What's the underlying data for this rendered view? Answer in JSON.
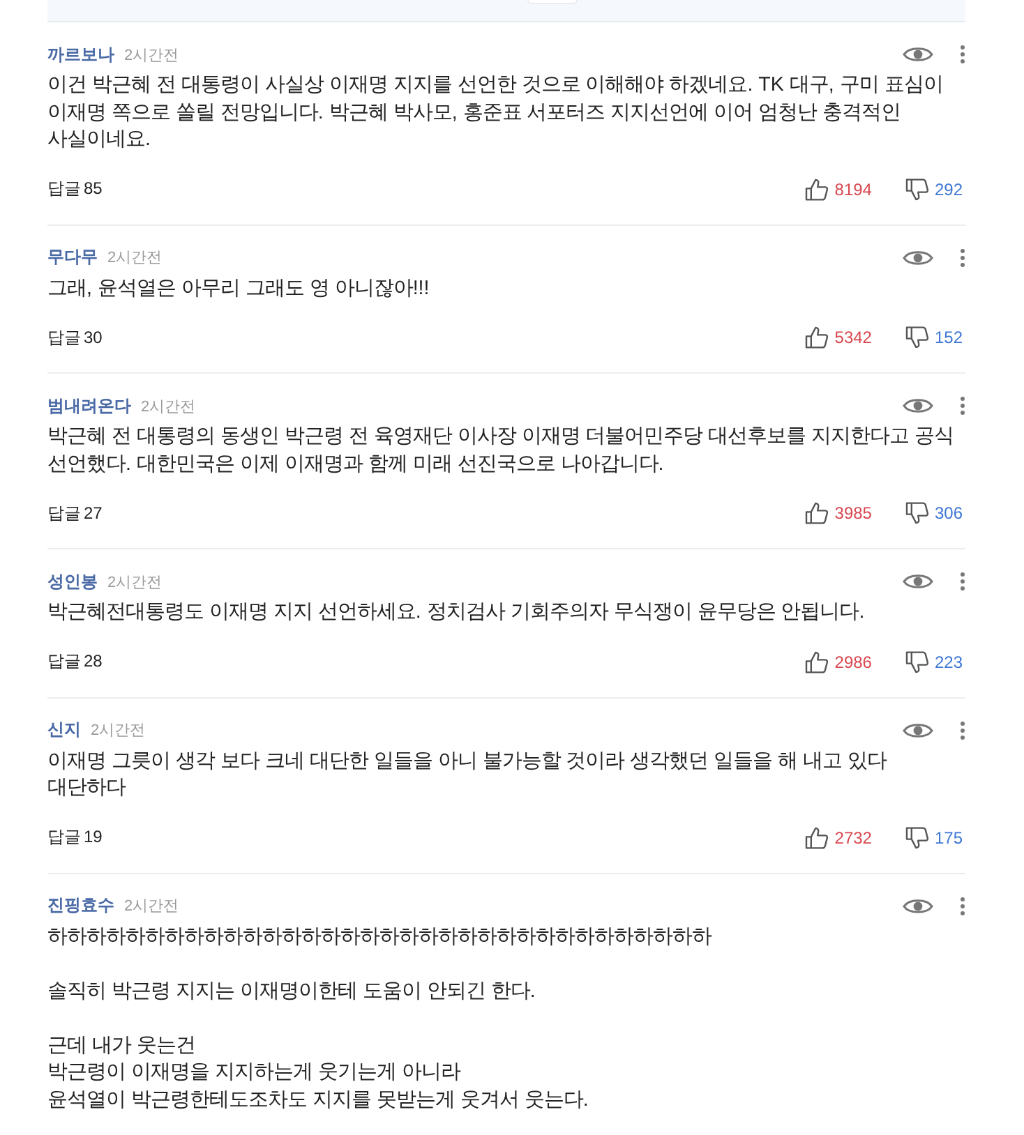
{
  "comments": [
    {
      "author": "까르보나",
      "time": "2시간전",
      "body": "이건 박근혜 전 대통령이 사실상 이재명 지지를 선언한 것으로 이해해야 하겠네요. TK 대구, 구미 표심이 이재명 쪽으로 쏠릴 전망입니다. 박근혜 박사모, 홍준표 서포터즈 지지선언에 이어 엄청난 충격적인 사실이네요.",
      "reply_label": "답글",
      "reply_count": "85",
      "likes": "8194",
      "dislikes": "292"
    },
    {
      "author": "무다무",
      "time": "2시간전",
      "body": "그래, 윤석열은 아무리 그래도 영 아니잖아!!!",
      "reply_label": "답글",
      "reply_count": "30",
      "likes": "5342",
      "dislikes": "152"
    },
    {
      "author": "범내려온다",
      "time": "2시간전",
      "body": "박근혜 전 대통령의 동생인 박근령 전 육영재단 이사장 이재명 더불어민주당 대선후보를 지지한다고 공식 선언했다. 대한민국은 이제 이재명과 함께 미래 선진국으로 나아갑니다.",
      "reply_label": "답글",
      "reply_count": "27",
      "likes": "3985",
      "dislikes": "306"
    },
    {
      "author": "성인봉",
      "time": "2시간전",
      "body": "박근혜전대통령도 이재명 지지 선언하세요. 정치검사 기회주의자 무식쟁이 윤무당은 안됩니다.",
      "reply_label": "답글",
      "reply_count": "28",
      "likes": "2986",
      "dislikes": "223"
    },
    {
      "author": "신지",
      "time": "2시간전",
      "body": "이재명 그릇이 생각 보다 크네 대단한 일들을 아니 불가능할 것이라 생각했던 일들을 해 내고 있다\n대단하다",
      "reply_label": "답글",
      "reply_count": "19",
      "likes": "2732",
      "dislikes": "175"
    },
    {
      "author": "진핑효수",
      "time": "2시간전",
      "body": "하하하하하하하하하하하하하하하하하하하하하하하하하하하하하하하하하하\n\n솔직히 박근령 지지는 이재명이한테 도움이 안되긴 한다.\n\n근데 내가 웃는건\n박근령이 이재명을 지지하는게 웃기는게 아니라\n윤석열이 박근령한테도조차도 지지를 못받는게 웃겨서 웃는다."
    }
  ]
}
